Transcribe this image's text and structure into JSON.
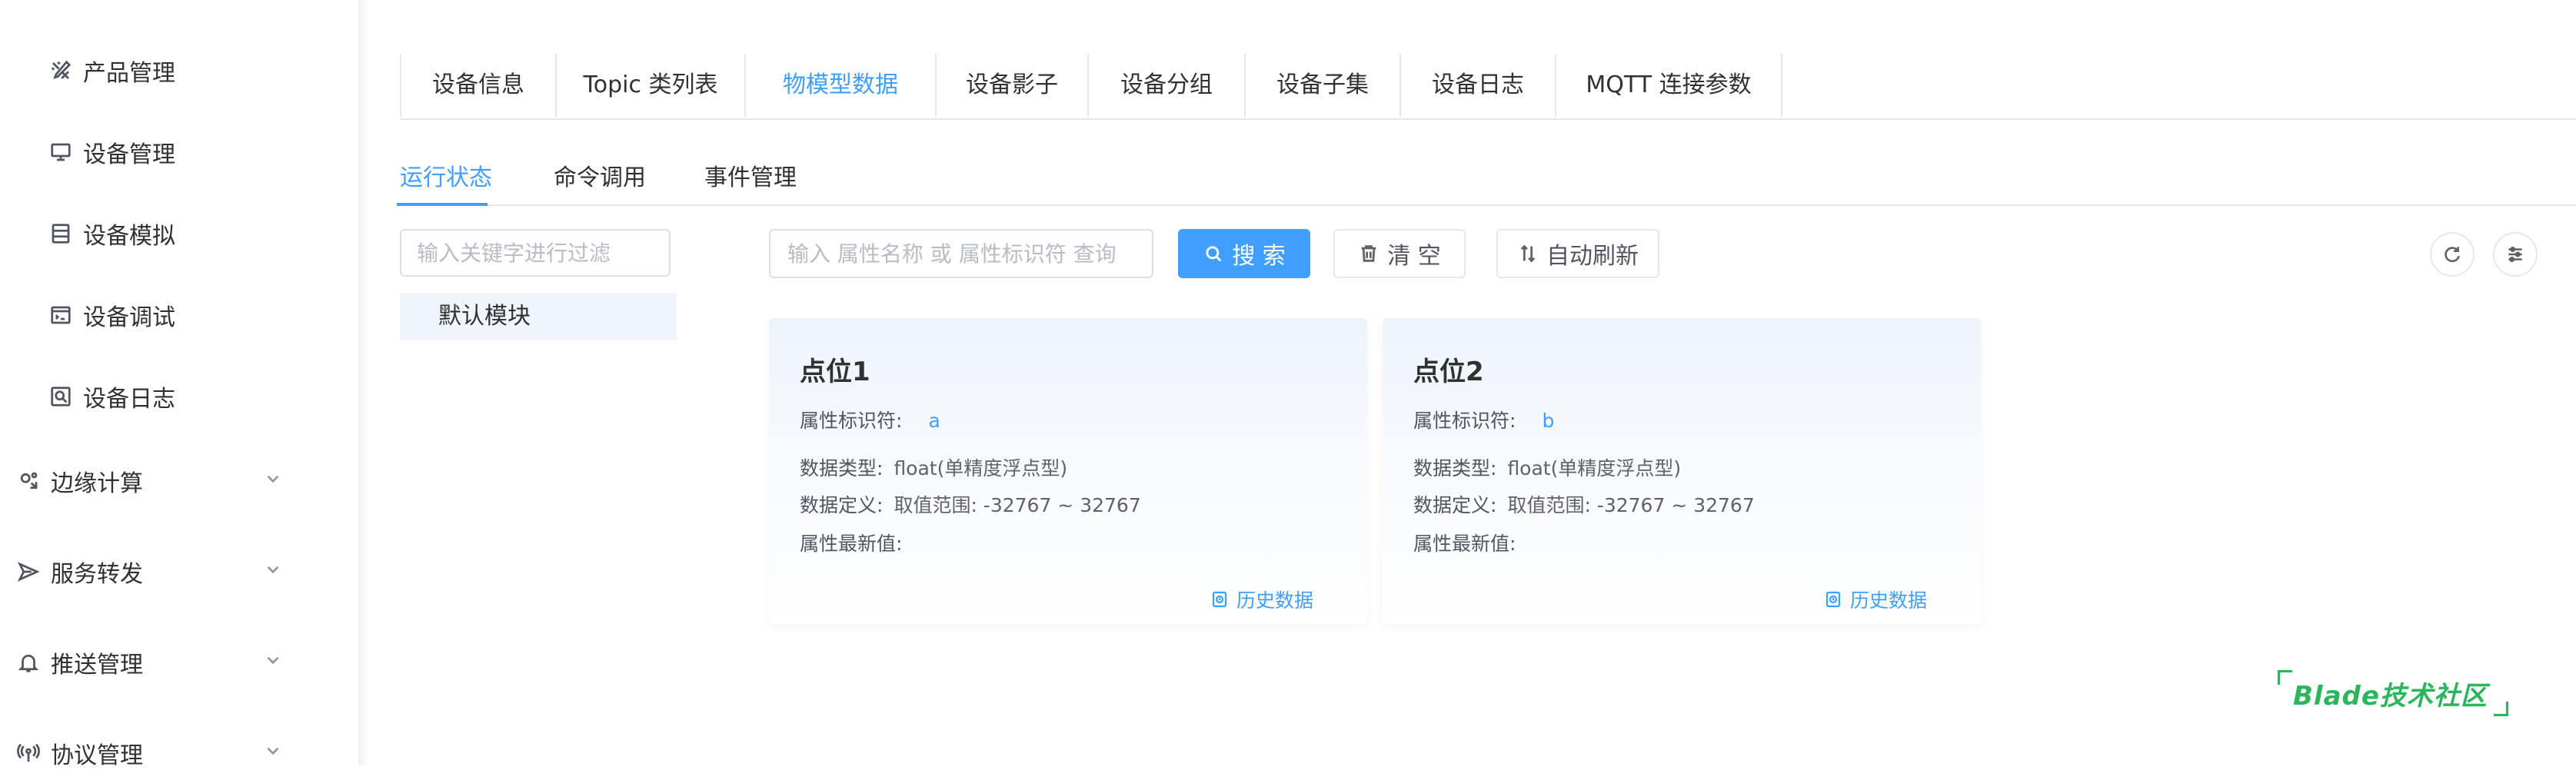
{
  "sidebar": {
    "items": [
      {
        "label": "产品管理",
        "icon": "tools-icon"
      },
      {
        "label": "设备管理",
        "icon": "monitor-icon"
      },
      {
        "label": "设备模拟",
        "icon": "simulator-icon"
      },
      {
        "label": "设备调试",
        "icon": "debug-icon"
      },
      {
        "label": "设备日志",
        "icon": "log-search-icon"
      }
    ],
    "groups": [
      {
        "label": "边缘计算",
        "icon": "edge-compute-icon"
      },
      {
        "label": "服务转发",
        "icon": "send-icon"
      },
      {
        "label": "推送管理",
        "icon": "bell-icon"
      },
      {
        "label": "协议管理",
        "icon": "broadcast-icon"
      }
    ]
  },
  "tabs": [
    "设备信息",
    "Topic 类列表",
    "物模型数据",
    "设备影子",
    "设备分组",
    "设备子集",
    "设备日志",
    "MQTT 连接参数"
  ],
  "active_tab": "物模型数据",
  "subtabs": [
    "运行状态",
    "命令调用",
    "事件管理"
  ],
  "active_subtab": "运行状态",
  "filter": {
    "placeholder": "输入关键字进行过滤",
    "module": "默认模块"
  },
  "toolbar": {
    "search_placeholder": "输入 属性名称 或 属性标识符 查询",
    "search_label": "搜 索",
    "clear_label": "清 空",
    "auto_refresh_label": "自动刷新"
  },
  "cards": [
    {
      "title": "点位1",
      "ident_label": "属性标识符:",
      "ident": "a",
      "type_label": "数据类型:",
      "type": "float(单精度浮点型)",
      "def_label": "数据定义:",
      "def": "取值范围: -32767 ~ 32767",
      "latest_label": "属性最新值:",
      "latest": "",
      "history_label": "历史数据"
    },
    {
      "title": "点位2",
      "ident_label": "属性标识符:",
      "ident": "b",
      "type_label": "数据类型:",
      "type": "float(单精度浮点型)",
      "def_label": "数据定义:",
      "def": "取值范围: -32767 ~ 32767",
      "latest_label": "属性最新值:",
      "latest": "",
      "history_label": "历史数据"
    }
  ],
  "watermark": "Blade技术社区",
  "colors": {
    "primary": "#409eff",
    "watermark": "#2db55d",
    "text": "#303133"
  }
}
